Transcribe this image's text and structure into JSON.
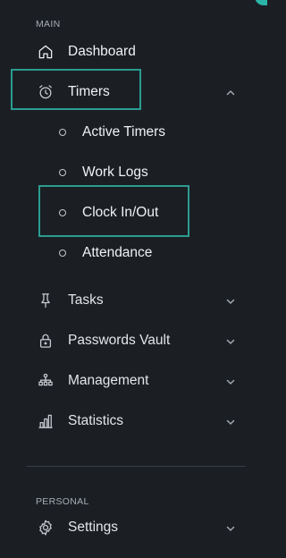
{
  "sections": {
    "main_label": "MAIN",
    "personal_label": "PERSONAL"
  },
  "nav": {
    "dashboard": {
      "label": "Dashboard",
      "icon": "home-icon"
    },
    "timers": {
      "label": "Timers",
      "icon": "alarm-clock-icon",
      "expanded": true,
      "children": [
        {
          "label": "Active Timers"
        },
        {
          "label": "Work Logs"
        },
        {
          "label": "Clock In/Out"
        },
        {
          "label": "Attendance"
        }
      ]
    },
    "tasks": {
      "label": "Tasks",
      "icon": "pin-icon"
    },
    "passwords_vault": {
      "label": "Passwords Vault",
      "icon": "lock-icon"
    },
    "management": {
      "label": "Management",
      "icon": "hierarchy-icon"
    },
    "statistics": {
      "label": "Statistics",
      "icon": "bar-chart-icon"
    },
    "settings": {
      "label": "Settings",
      "icon": "gear-icon"
    }
  },
  "colors": {
    "background": "#1b1f24",
    "accent": "#2bb5a8",
    "highlight_border": "#2b9c91",
    "text": "#f0f2f4",
    "muted": "#a8adb5"
  }
}
